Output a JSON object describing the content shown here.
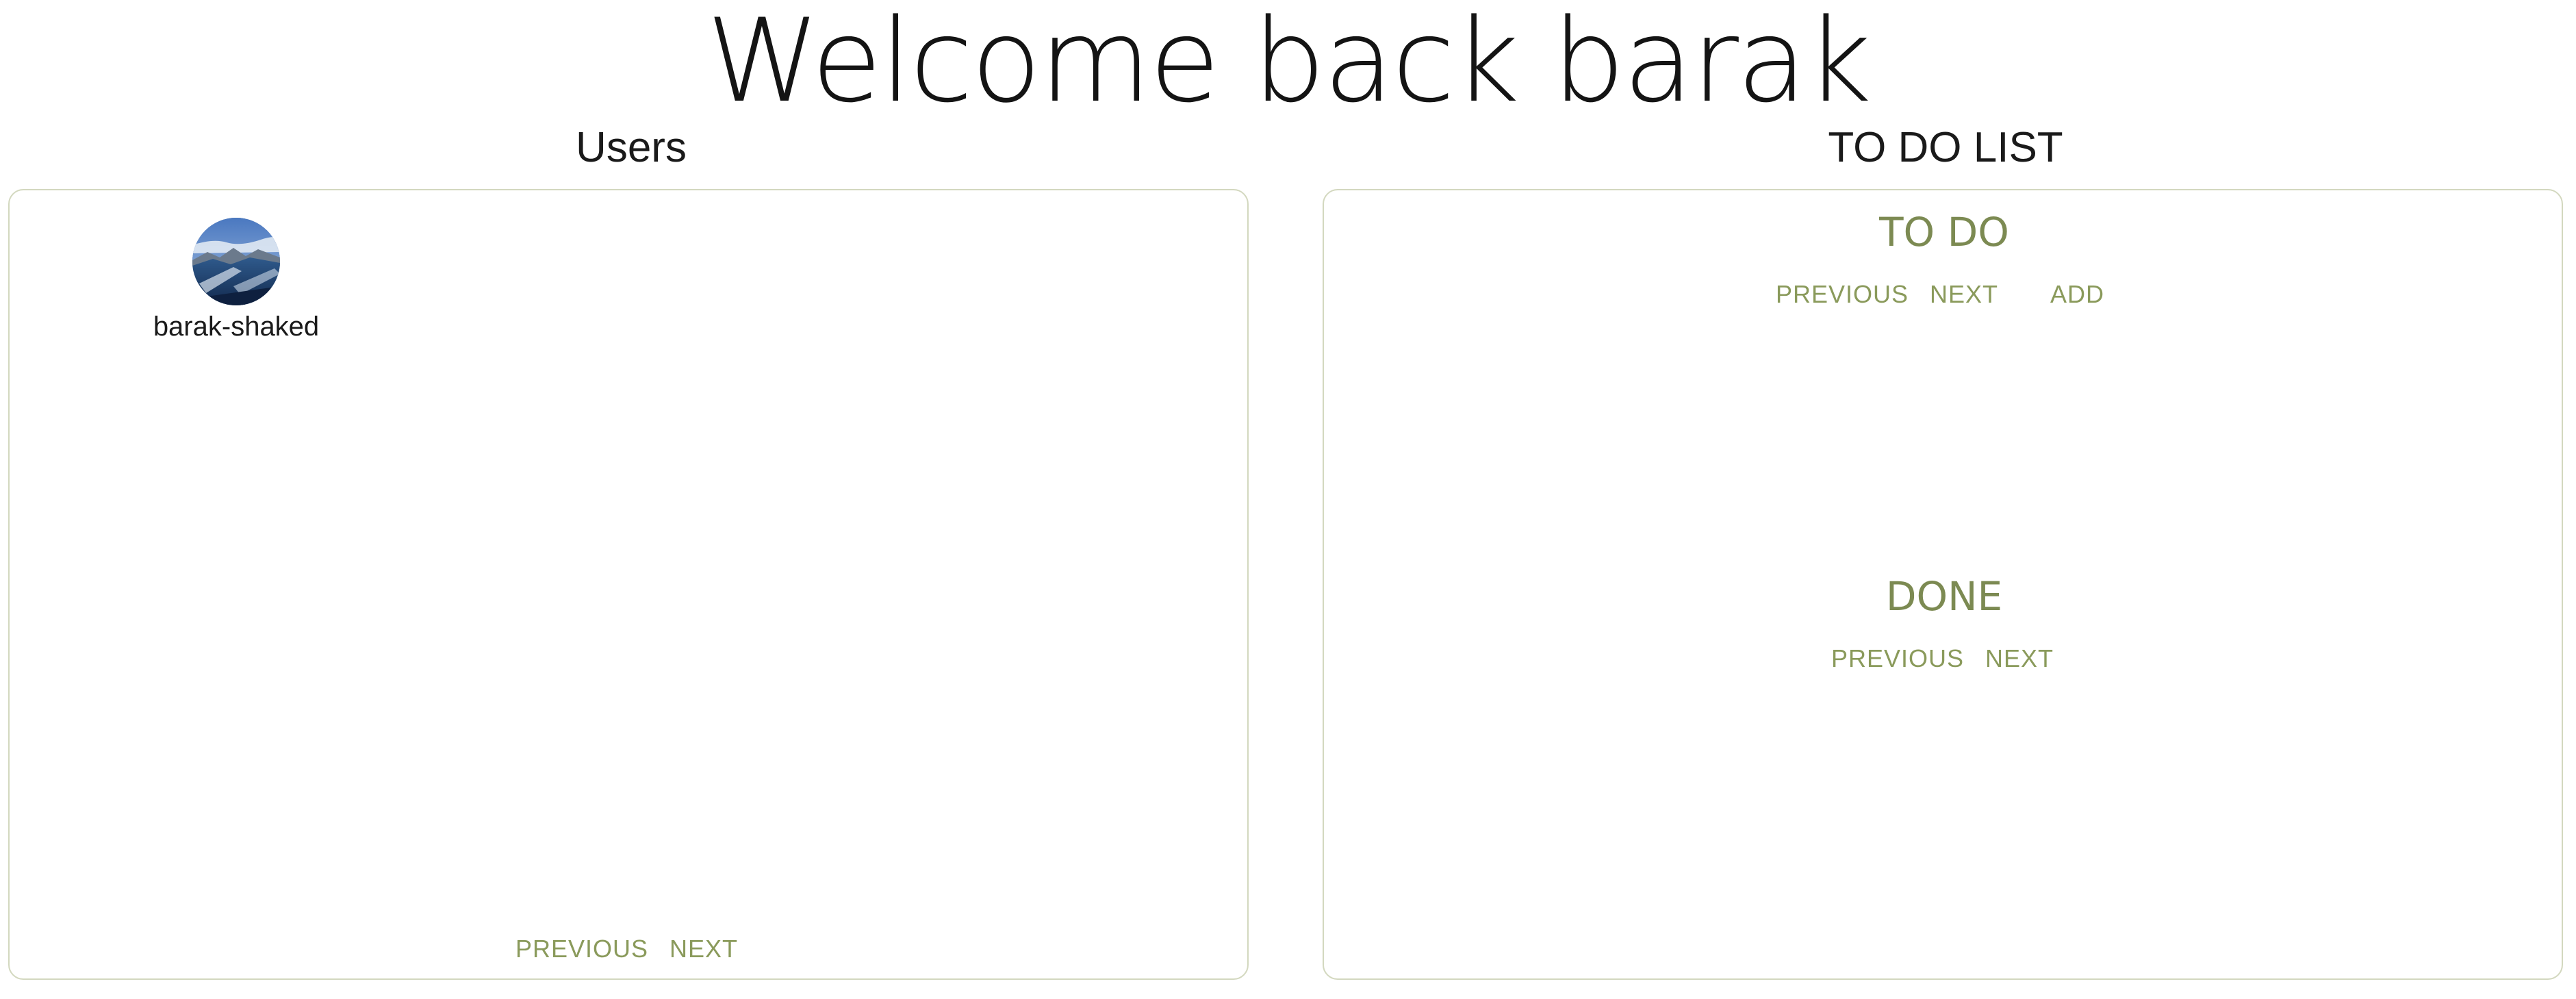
{
  "header": {
    "welcome": "Welcome back barak"
  },
  "users_panel": {
    "title": "Users",
    "users": [
      {
        "name": "barak-shaked",
        "avatar": "mountain-landscape-avatar"
      }
    ],
    "previous_label": "PREVIOUS",
    "next_label": "NEXT"
  },
  "todo_panel": {
    "title": "TO DO LIST",
    "todo_section": {
      "heading": "TO DO",
      "previous_label": "PREVIOUS",
      "next_label": "NEXT",
      "add_label": "ADD"
    },
    "done_section": {
      "heading": "DONE",
      "previous_label": "PREVIOUS",
      "next_label": "NEXT"
    }
  },
  "colors": {
    "accent": "#8a9a5b",
    "heading_accent": "#7c8a52",
    "panel_border": "#d3d8bf"
  }
}
